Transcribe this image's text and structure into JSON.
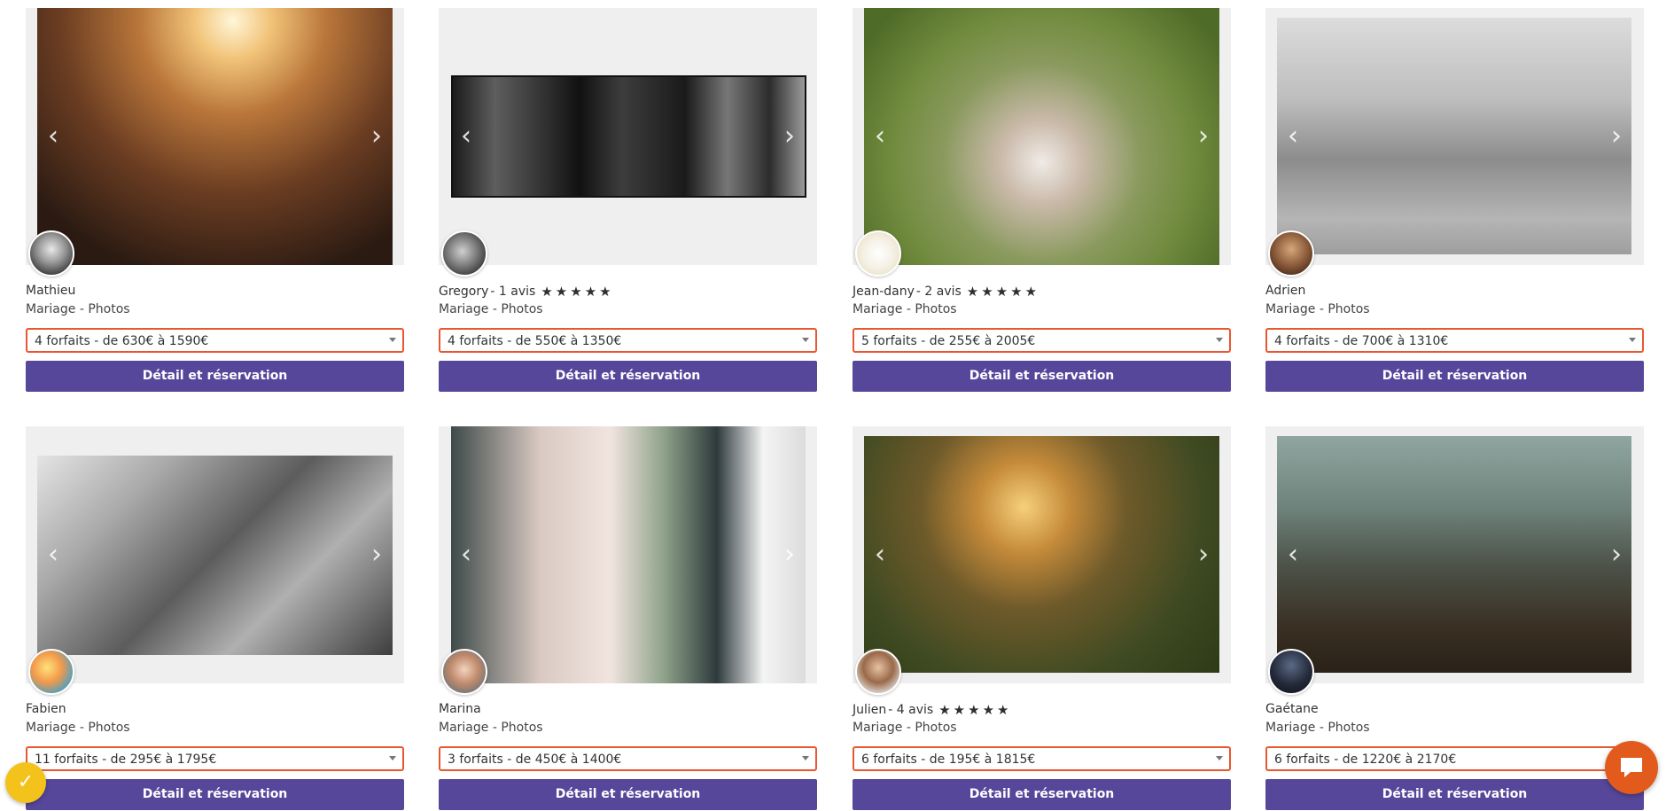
{
  "cards": [
    {
      "name": "Mathieu",
      "reviews": "",
      "stars": 0,
      "category": "Mariage - Photos",
      "packages": "4 forfaits - de 630€ à 1590€",
      "button": "Détail et réservation"
    },
    {
      "name": "Gregory",
      "reviews": " - 1 avis",
      "stars": 5,
      "category": "Mariage - Photos",
      "packages": "4 forfaits - de 550€ à 1350€",
      "button": "Détail et réservation"
    },
    {
      "name": "Jean-dany",
      "reviews": " - 2 avis",
      "stars": 5,
      "category": "Mariage - Photos",
      "packages": "5 forfaits - de 255€ à 2005€",
      "button": "Détail et réservation"
    },
    {
      "name": "Adrien",
      "reviews": "",
      "stars": 0,
      "category": "Mariage - Photos",
      "packages": "4 forfaits - de 700€ à 1310€",
      "button": "Détail et réservation"
    },
    {
      "name": "Fabien",
      "reviews": "",
      "stars": 0,
      "category": "Mariage - Photos",
      "packages": "11 forfaits - de 295€ à 1795€",
      "button": "Détail et réservation"
    },
    {
      "name": "Marina",
      "reviews": "",
      "stars": 0,
      "category": "Mariage - Photos",
      "packages": "3 forfaits - de 450€ à 1400€",
      "button": "Détail et réservation"
    },
    {
      "name": "Julien",
      "reviews": " - 4 avis",
      "stars": 5,
      "category": "Mariage - Photos",
      "packages": "6 forfaits - de 195€ à 1815€",
      "button": "Détail et réservation"
    },
    {
      "name": "Gaétane",
      "reviews": "",
      "stars": 0,
      "category": "Mariage - Photos",
      "packages": "6 forfaits - de 1220€ à 2170€",
      "button": "Détail et réservation"
    }
  ],
  "icons": {
    "prev": "chevron-left-icon",
    "next": "chevron-right-icon",
    "star": "star-icon",
    "caret": "caret-down-icon",
    "badge": "checkmark-badge-icon",
    "chat": "chat-bubble-icon"
  },
  "colors": {
    "button": "#56479b",
    "select_border": "#e8572f",
    "chat_widget": "#e25a1c",
    "badge_widget": "#f3c21b"
  }
}
